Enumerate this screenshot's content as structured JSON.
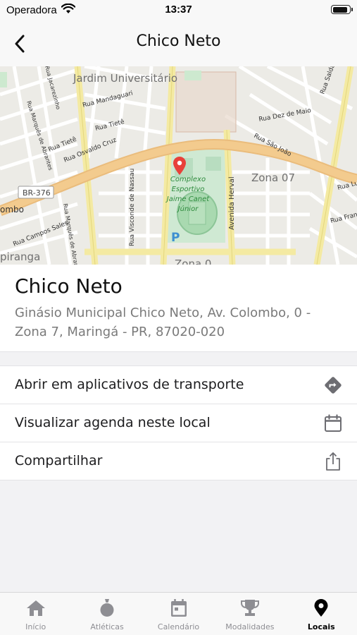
{
  "status_bar": {
    "carrier": "Operadora",
    "time": "13:37",
    "battery_level": 0.92
  },
  "nav": {
    "title": "Chico Neto",
    "back_icon": "chevron-left-icon"
  },
  "map": {
    "labels": {
      "jardim": "Jardim Universitário",
      "zona07": "Zona 07",
      "zona": "Zona 0",
      "br376": "BR-376",
      "colombo": "ombo",
      "piranga": "piranga",
      "mandaguari": "Rua Mandaguari",
      "tiete1": "Rua Tietê",
      "tiete2": "Rua Tietê",
      "osvaldo": "Rua Osvaldo Cruz",
      "campos": "Rua Campos Sales",
      "dezmaio": "Rua Dez de Maio",
      "saojoao": "Rua São João",
      "saldanha": "Rua Saldanha",
      "rua_left": "Rua Marquês de Abrantes",
      "rua_left2": "Rua Jacarezinho",
      "rua_left3": "Rua Marquês de Abrantes",
      "nassau": "Rua Visconde de Nassau",
      "herval": "Avenida Herval",
      "rua_fran": "Rua Fran",
      "rua_lr": "Rua Lu",
      "complexo1": "Complexo",
      "complexo2": "Esportivo",
      "complexo3": "Jaime Canet",
      "complexo4": "Júnior",
      "parking": "P"
    },
    "pin_color": "#e8413a"
  },
  "place": {
    "name": "Chico Neto",
    "address": "Ginásio Municipal Chico Neto, Av. Colombo, 0 - Zona 7, Maringá - PR, 87020-020"
  },
  "actions": [
    {
      "label": "Abrir em aplicativos de transporte",
      "icon": "directions-icon"
    },
    {
      "label": "Visualizar agenda neste local",
      "icon": "calendar-icon"
    },
    {
      "label": "Compartilhar",
      "icon": "share-icon"
    }
  ],
  "tabs": [
    {
      "label": "Início",
      "icon": "home-icon",
      "active": false
    },
    {
      "label": "Atléticas",
      "icon": "medal-icon",
      "active": false
    },
    {
      "label": "Calendário",
      "icon": "calendar-icon",
      "active": false
    },
    {
      "label": "Modalidades",
      "icon": "trophy-icon",
      "active": false
    },
    {
      "label": "Locais",
      "icon": "location-pin-icon",
      "active": true
    }
  ]
}
